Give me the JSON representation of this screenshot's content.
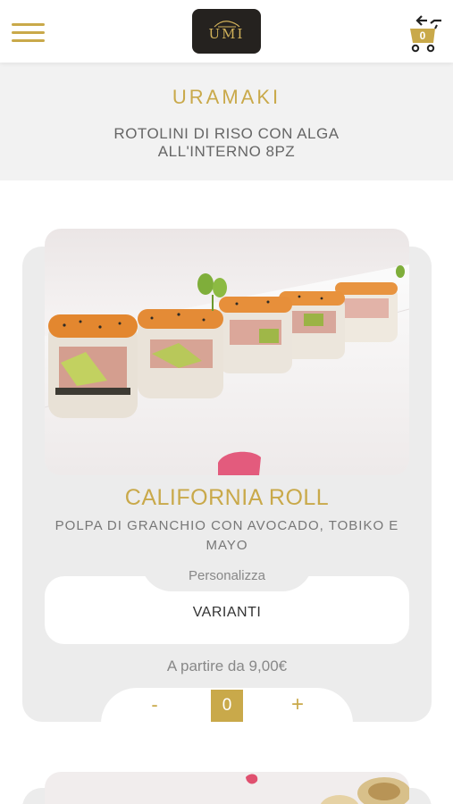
{
  "header": {
    "logo_text": "UMI",
    "cart_count": "0"
  },
  "section": {
    "title": "URAMAKI",
    "subtitle": "ROTOLINI DI RISO CON ALGA ALL'INTERNO 8PZ"
  },
  "product": {
    "name": "CALIFORNIA ROLL",
    "description": "POLPA DI GRANCHIO CON AVOCADO, TOBIKO E MAYO",
    "personalize_label": "Personalizza",
    "variants_label": "VARIANTI",
    "price_text": "A partire da 9,00€",
    "minus_label": "-",
    "quantity": "0",
    "plus_label": "+"
  },
  "colors": {
    "accent": "#c9a94a",
    "card_bg": "#ececec",
    "header_bg": "#f2f2f2",
    "logo_bg": "#25221f"
  }
}
